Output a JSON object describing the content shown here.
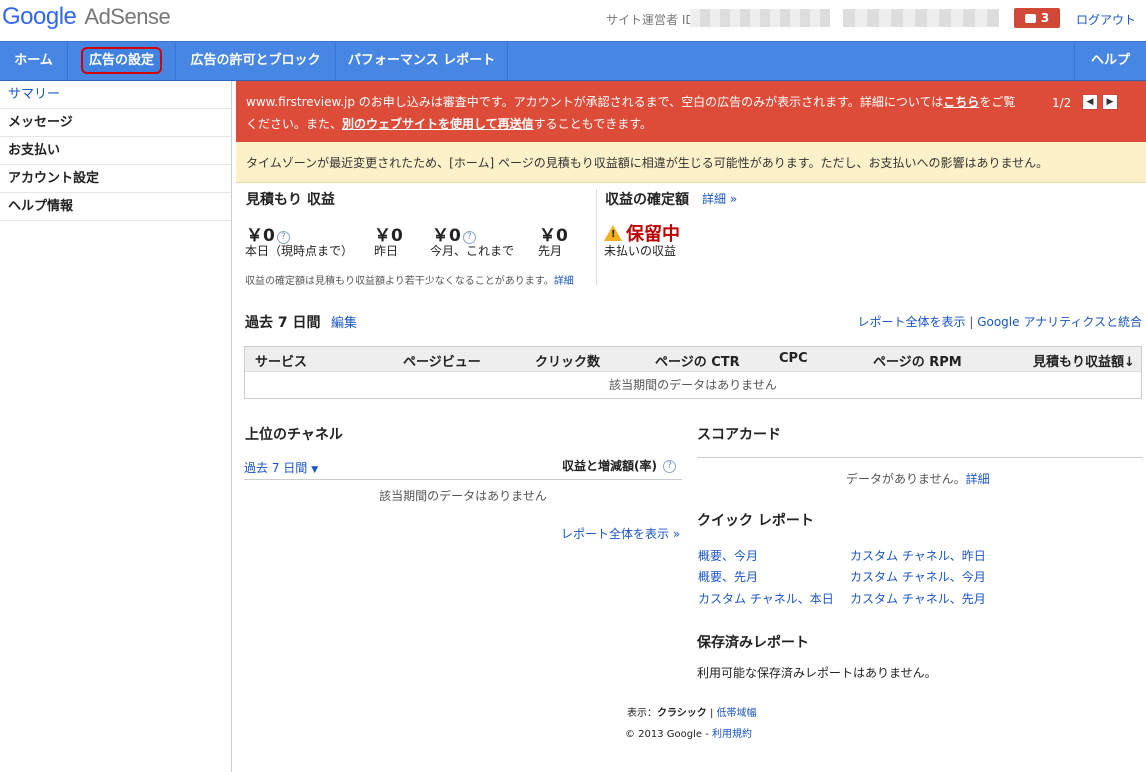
{
  "header": {
    "logo_google": "Google",
    "logo_product": "AdSense",
    "publisher_id_label": "サイト運営者 ID:",
    "notification_count": "3",
    "logout": "ログアウト"
  },
  "nav": {
    "items": [
      {
        "label": "ホーム"
      },
      {
        "label": "広告の設定"
      },
      {
        "label": "広告の許可とブロック"
      },
      {
        "label": "パフォーマンス レポート"
      }
    ],
    "help": "ヘルプ"
  },
  "sidebar": {
    "items": [
      {
        "label": "サマリー"
      },
      {
        "label": "メッセージ"
      },
      {
        "label": "お支払い"
      },
      {
        "label": "アカウント設定"
      },
      {
        "label": "ヘルプ情報"
      }
    ]
  },
  "alert": {
    "text_1": "www.firstreview.jp のお申し込みは審査中です。アカウントが承認されるまで、空白の広告のみが表示されます。詳細については",
    "link_here": "こちら",
    "text_2": "をご覧ください。また、",
    "link_other": "別のウェブサイトを使用して再送信",
    "text_3": "することもできます。",
    "pager": "1/2",
    "prev": "◀",
    "next": "▶"
  },
  "warning": "タイムゾーンが最近変更されたため、[ホーム] ページの見積もり収益額に相違が生じる可能性があります。ただし、お支払いへの影響はありません。",
  "estimated": {
    "title": "見積もり 収益",
    "items": [
      {
        "value": "￥0",
        "label": "本日（現時点まで）"
      },
      {
        "value": "￥0",
        "label": "昨日"
      },
      {
        "value": "￥0",
        "label": "今月、これまで"
      },
      {
        "value": "￥0",
        "label": "先月"
      }
    ],
    "note": "収益の確定額は見積もり収益額より若干少なくなることがあります。",
    "note_link": "詳細"
  },
  "finalized": {
    "title": "収益の確定額",
    "details_link": "詳細 »",
    "status": "保留中",
    "sublabel": "未払いの収益"
  },
  "performance": {
    "period_title": "過去 7 日間",
    "edit_link": "編集",
    "full_report_link": "レポート全体を表示",
    "separator": "|",
    "analytics_link": "Google アナリティクスと統合",
    "columns": [
      "サービス",
      "ページビュー",
      "クリック数",
      "ページの CTR",
      "CPC",
      "ページの RPM",
      "見積もり収益額↓"
    ],
    "empty": "該当期間のデータはありません"
  },
  "channels": {
    "title": "上位のチャネル",
    "period_select": "過去 7 日間",
    "column_label": "収益と増減額(率)",
    "empty": "該当期間のデータはありません",
    "full_report_link": "レポート全体を表示 »"
  },
  "scorecard": {
    "title": "スコアカード",
    "empty": "データがありません。",
    "details_link": "詳細"
  },
  "quick_reports": {
    "title": "クイック レポート",
    "links": [
      "概要、今月",
      "概要、先月",
      "カスタム チャネル、本日",
      "カスタム チャネル、昨日",
      "カスタム チャネル、今月",
      "カスタム チャネル、先月"
    ]
  },
  "saved_reports": {
    "title": "保存済みレポート",
    "empty": "利用可能な保存済みレポートはありません。"
  },
  "footer": {
    "display_label": "表示：",
    "classic": "クラシック",
    "separator": "|",
    "low_bandwidth": "低帯域幅",
    "copyright": "© 2013 Google - ",
    "terms": "利用規約"
  }
}
